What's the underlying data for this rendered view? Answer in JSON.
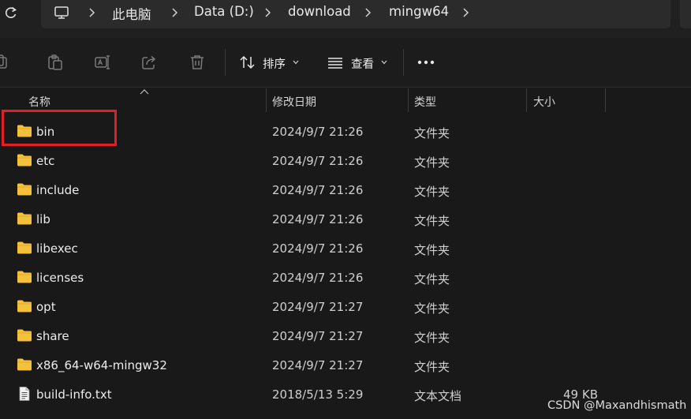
{
  "address": {
    "refresh_icon": "refresh-icon",
    "pc_icon": "computer-icon",
    "segments": [
      "此电脑",
      "Data (D:)",
      "download",
      "mingw64"
    ]
  },
  "toolbar": {
    "copy_icon": "copy-icon",
    "paste_icon": "paste-icon",
    "rename_icon": "rename-icon",
    "share_icon": "share-icon",
    "delete_icon": "delete-icon",
    "sort_label": "排序",
    "view_label": "查看",
    "more_label": "•••"
  },
  "columns": {
    "name": "名称",
    "date": "修改日期",
    "type": "类型",
    "size": "大小"
  },
  "files": [
    {
      "name": "bin",
      "date": "2024/9/7 21:26",
      "type": "文件夹",
      "size": "",
      "icon": "folder-icon"
    },
    {
      "name": "etc",
      "date": "2024/9/7 21:26",
      "type": "文件夹",
      "size": "",
      "icon": "folder-icon"
    },
    {
      "name": "include",
      "date": "2024/9/7 21:26",
      "type": "文件夹",
      "size": "",
      "icon": "folder-icon"
    },
    {
      "name": "lib",
      "date": "2024/9/7 21:26",
      "type": "文件夹",
      "size": "",
      "icon": "folder-icon"
    },
    {
      "name": "libexec",
      "date": "2024/9/7 21:26",
      "type": "文件夹",
      "size": "",
      "icon": "folder-icon"
    },
    {
      "name": "licenses",
      "date": "2024/9/7 21:26",
      "type": "文件夹",
      "size": "",
      "icon": "folder-icon"
    },
    {
      "name": "opt",
      "date": "2024/9/7 21:27",
      "type": "文件夹",
      "size": "",
      "icon": "folder-icon"
    },
    {
      "name": "share",
      "date": "2024/9/7 21:27",
      "type": "文件夹",
      "size": "",
      "icon": "folder-icon"
    },
    {
      "name": "x86_64-w64-mingw32",
      "date": "2024/9/7 21:27",
      "type": "文件夹",
      "size": "",
      "icon": "folder-icon"
    },
    {
      "name": "build-info.txt",
      "date": "2018/5/13 5:29",
      "type": "文本文档",
      "size": "49 KB",
      "icon": "text-file-icon"
    }
  ],
  "watermark": "CSDN @Maxandhismath",
  "colors": {
    "background": "#191919",
    "highlight": "#e31e24",
    "folder": "#f4c13d"
  }
}
